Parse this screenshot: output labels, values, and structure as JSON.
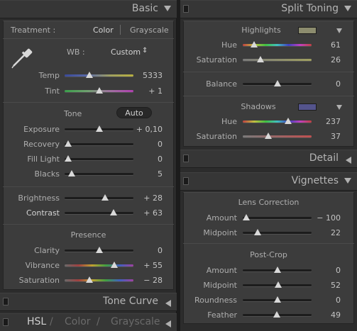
{
  "basic": {
    "title": "Basic",
    "treatment_label": "Treatment :",
    "treatment_color": "Color",
    "treatment_gray": "Grayscale",
    "wb_label": "WB :",
    "wb_value": "Custom",
    "wb_arrows": "⇕",
    "temp": {
      "label": "Temp",
      "value": "5333",
      "pos": 0.36
    },
    "tint": {
      "label": "Tint",
      "value": "+ 1",
      "pos": 0.51
    },
    "tone_label": "Tone",
    "auto_label": "Auto",
    "exposure": {
      "label": "Exposure",
      "value": "+ 0,10",
      "pos": 0.51
    },
    "recovery": {
      "label": "Recovery",
      "value": "0",
      "pos": 0.0
    },
    "fill_light": {
      "label": "Fill Light",
      "value": "0",
      "pos": 0.0
    },
    "blacks": {
      "label": "Blacks",
      "value": "5",
      "pos": 0.05
    },
    "brightness": {
      "label": "Brightness",
      "value": "+ 28",
      "pos": 0.59
    },
    "contrast": {
      "label": "Contrast",
      "value": "+ 63",
      "pos": 0.71
    },
    "presence_label": "Presence",
    "clarity": {
      "label": "Clarity",
      "value": "0",
      "pos": 0.5
    },
    "vibrance": {
      "label": "Vibrance",
      "value": "+ 55",
      "pos": 0.72
    },
    "saturation": {
      "label": "Saturation",
      "value": "− 28",
      "pos": 0.36
    }
  },
  "tone_curve": {
    "title": "Tone Curve"
  },
  "hsl": {
    "tab_hsl": "HSL",
    "tab_color": "Color",
    "tab_gray": "Grayscale",
    "slash": "/"
  },
  "split_toning": {
    "title": "Split Toning",
    "highlights_label": "Highlights",
    "highlights_color": "#8c8c6e",
    "hl_hue": {
      "label": "Hue",
      "value": "61",
      "pos": 0.17
    },
    "hl_sat": {
      "label": "Saturation",
      "value": "26",
      "pos": 0.26
    },
    "balance": {
      "label": "Balance",
      "value": "0",
      "pos": 0.5
    },
    "shadows_label": "Shadows",
    "shadows_color": "#54548c",
    "sh_hue": {
      "label": "Hue",
      "value": "237",
      "pos": 0.66
    },
    "sh_sat": {
      "label": "Saturation",
      "value": "37",
      "pos": 0.37
    }
  },
  "detail": {
    "title": "Detail"
  },
  "vignettes": {
    "title": "Vignettes",
    "lens_label": "Lens Correction",
    "lens_amount": {
      "label": "Amount",
      "value": "− 100",
      "pos": 0.0
    },
    "lens_midpoint": {
      "label": "Midpoint",
      "value": "22",
      "pos": 0.22
    },
    "postcrop_label": "Post-Crop",
    "pc_amount": {
      "label": "Amount",
      "value": "0",
      "pos": 0.5
    },
    "pc_midpoint": {
      "label": "Midpoint",
      "value": "52",
      "pos": 0.52
    },
    "pc_roundness": {
      "label": "Roundness",
      "value": "0",
      "pos": 0.5
    },
    "pc_feather": {
      "label": "Feather",
      "value": "49",
      "pos": 0.49
    }
  }
}
